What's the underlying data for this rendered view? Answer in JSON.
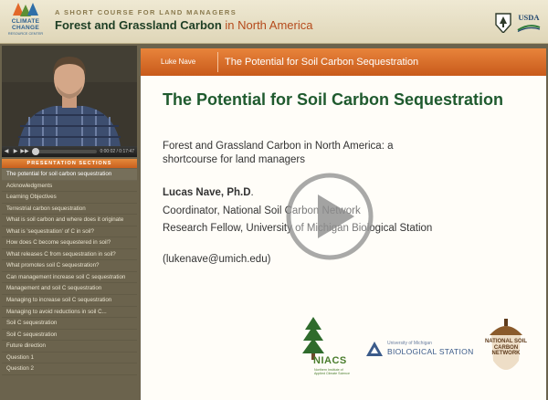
{
  "header": {
    "logo": {
      "line1": "CLIMATE",
      "line2": "CHANGE",
      "line3": "RESOURCE CENTER"
    },
    "tagline": "A SHORT COURSE FOR LAND MANAGERS",
    "course_title": "Forest and Grassland Carbon",
    "course_title_suffix": "in North America",
    "usda_label": "USDA"
  },
  "player": {
    "time": "0:00:02 / 0:17:47",
    "progress": 0.002
  },
  "sections": {
    "header": "PRESENTATION SECTIONS",
    "items": [
      "The potential for soil carbon sequestration",
      "Acknowledgments",
      "Learning Objectives",
      "Terrestrial carbon sequestration",
      "What is soil carbon and where does it originate",
      "What is 'sequestration' of C in soil?",
      "How does C become sequestered in soil?",
      "What releases C from sequestration in soil?",
      "What promotes soil C sequestration?",
      "Can management increase soil C sequestration",
      "Management and soil C sequestration",
      "Managing to increase soil C sequestration",
      "Managing to avoid reductions in soil C...",
      "Soil C sequestration",
      "Soil C sequestration",
      "Future direction",
      "Question 1",
      "Question 2"
    ],
    "active_index": 0
  },
  "slide_bar": {
    "presenter": "Luke Nave",
    "title": "The Potential for Soil Carbon Sequestration"
  },
  "slide": {
    "heading": "The Potential for Soil Carbon Sequestration",
    "subtitle": "Forest and Grassland Carbon in North America: a shortcourse for land managers",
    "speaker_name": "Lucas Nave, Ph.D",
    "speaker_dot": ".",
    "role1": "Coordinator, National Soil Carbon Network",
    "role2": "Research Fellow, University of Michigan Biological Station",
    "email": "(lukenave@umich.edu)",
    "logos": {
      "niacs_name": "NIACS",
      "niacs_full": "Northern Institute of Applied Climate Science",
      "bio_small": "University of Michigan",
      "bio_name": "BIOLOGICAL STATION",
      "nscn_text": "NATIONAL SOIL CARBON NETWORK"
    }
  },
  "colors": {
    "accent_orange": "#d8692a",
    "heading_green": "#1f5a2e",
    "panel_brown": "#6b634d"
  }
}
